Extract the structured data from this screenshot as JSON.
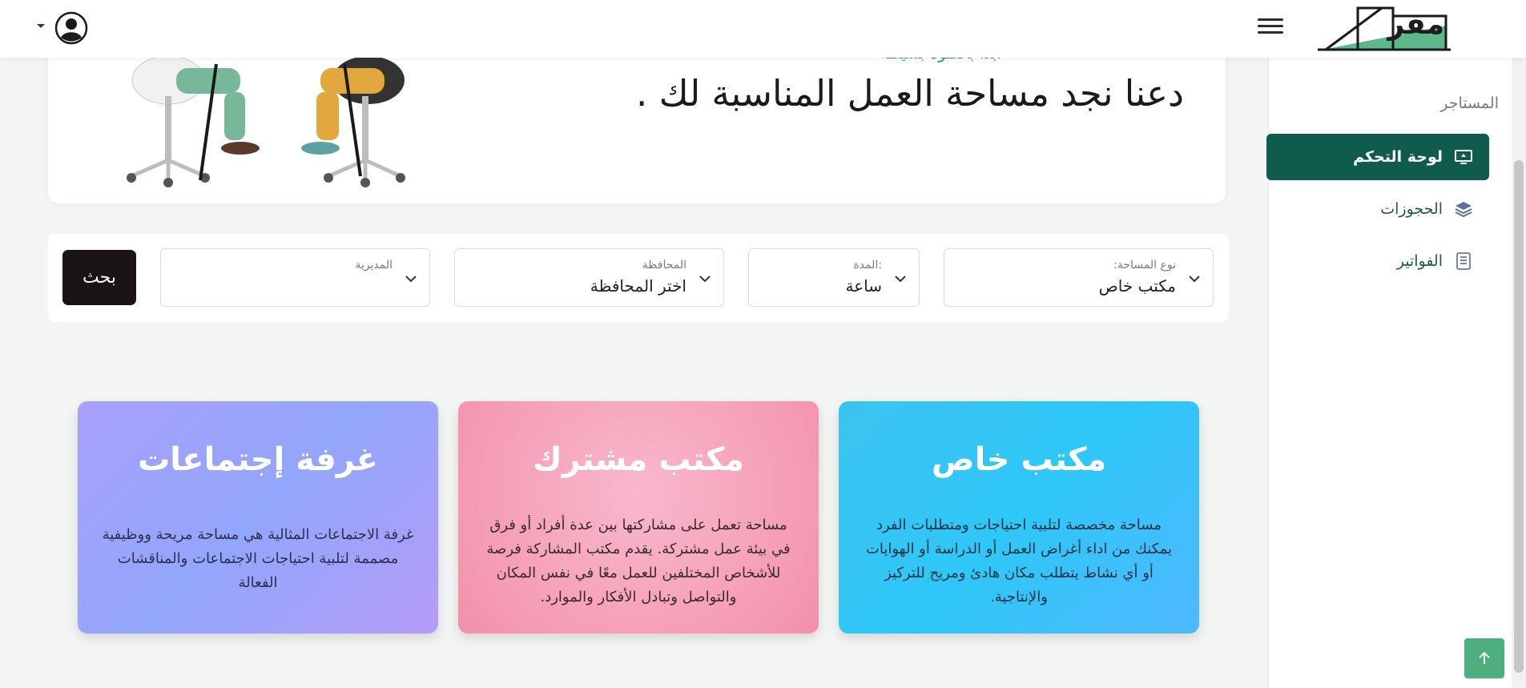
{
  "header": {
    "logo_text": "مقر",
    "colors": {
      "brand": "#0f5c4f",
      "accent": "#4caf7d"
    }
  },
  "sidebar": {
    "heading": "المستاجر",
    "items": [
      {
        "label": "لوحة التحكم",
        "icon": "monitor-icon",
        "active": true
      },
      {
        "label": "الحجوزات",
        "icon": "layers-icon",
        "active": false
      },
      {
        "label": "الفواتير",
        "icon": "invoice-icon",
        "active": false
      }
    ]
  },
  "hero": {
    "subtitle": "ابدأ بخطوة بسيطة",
    "title": "دعنا نجد مساحة العمل المناسبة لك ."
  },
  "filters": {
    "space_type": {
      "label": "نوع المساحة:",
      "value": "مكتب خاص"
    },
    "duration": {
      "label": ":المدة",
      "value": "ساعة"
    },
    "governorate": {
      "label": "المحافظة",
      "value": "اختر المحافظة"
    },
    "directorate": {
      "label": "المديرية",
      "value": ""
    },
    "search_label": "بحث"
  },
  "cards": [
    {
      "title": "مكتب خاص",
      "description": "مساحة مخصصة لتلبية احتياجات ومتطلبات الفرد يمكنك من اداء أغراض العمل أو الدراسة أو الهوايات أو أي نشاط يتطلب مكان هادئ ومريح للتركيز والإنتاجية."
    },
    {
      "title": "مكتب مشترك",
      "description": "مساحة تعمل على مشاركتها بين عدة أفراد أو فرق في بيئة عمل مشتركة. يقدم مكتب المشاركة فرصة للأشخاص المختلفين للعمل معًا في نفس المكان والتواصل وتبادل الأفكار والموارد."
    },
    {
      "title": "غرفة إجتماعات",
      "description": "غرفة الاجتماعات المثالية هي مساحة مريحة ووظيفية مصممة لتلبية احتياجات الاجتماعات والمناقشات الفعالة"
    }
  ]
}
